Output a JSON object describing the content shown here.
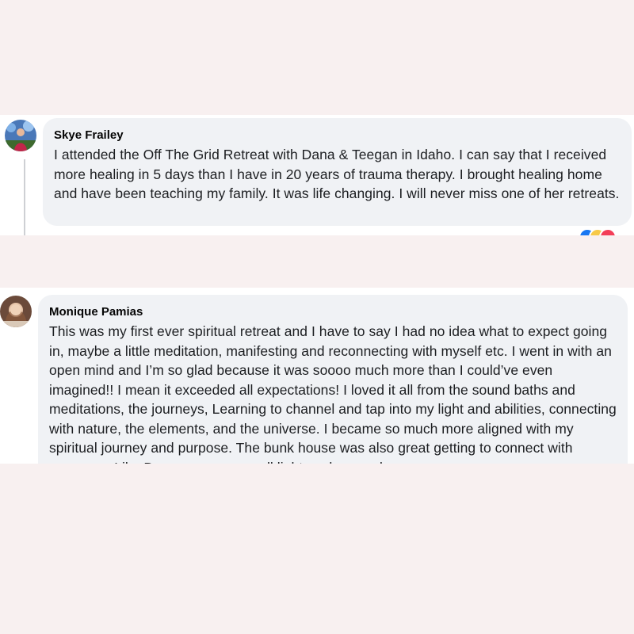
{
  "comments": [
    {
      "author": "Skye Frailey",
      "text": "I attended the Off The Grid Retreat with Dana & Teegan in Idaho. I can say that I received more healing in 5 days than I have in 20 years of trauma therapy. I brought healing home and have been teaching my family. It was life changing. I will never miss one of her retreats.",
      "reactions": [
        "like-icon",
        "haha-icon",
        "love-icon"
      ]
    },
    {
      "author": "Monique Pamias",
      "text": "This was my first ever spiritual retreat and I have to say I had no idea what to expect going in, maybe a little meditation, manifesting and reconnecting with myself etc. I went in with an open mind and I’m so glad because it was soooo much more than I could’ve even imagined!! I mean it exceeded all expectations! I loved it all from the sound baths and meditations, the journeys, Learning to channel and tap into my light and abilities, connecting with nature, the elements, and the universe. I became so much more aligned with my spiritual journey and purpose. The bunk house was also great getting to connect with everyone. Like Dana says we are all light workers and"
    }
  ],
  "colors": {
    "page_background": "#f8f0f0",
    "card_background": "#ffffff",
    "bubble_background": "#f0f2f5",
    "text": "#1c1e21",
    "like": "#1877f2",
    "haha": "#f7c948",
    "love": "#f33e58"
  }
}
